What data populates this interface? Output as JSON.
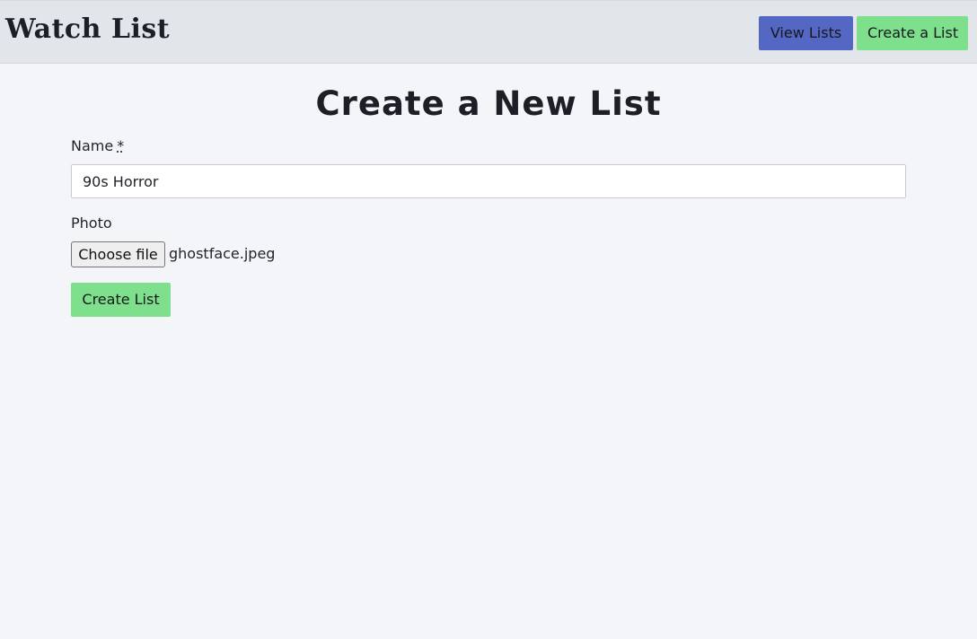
{
  "header": {
    "brand": "Watch List",
    "nav": {
      "view_lists": "View Lists",
      "create_list": "Create a List"
    }
  },
  "main": {
    "title": "Create a New List",
    "form": {
      "name_label": "Name",
      "required_marker": "*",
      "name_value": "90s Horror",
      "photo_label": "Photo",
      "file_button": "Choose file",
      "file_name": "ghostface.jpeg",
      "submit_label": "Create List"
    }
  },
  "colors": {
    "header_bg": "#e2e5ea",
    "page_bg": "#f3f5f8",
    "primary": "#5467c2",
    "success": "#7edf8c"
  }
}
